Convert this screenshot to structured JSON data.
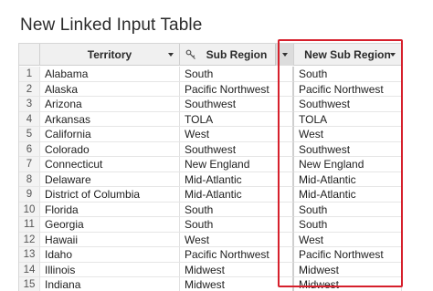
{
  "title": "New Linked Input Table",
  "columns": {
    "territory": "Territory",
    "sub_region": "Sub Region",
    "new_sub_region": "New Sub Region"
  },
  "icons": {
    "key": "key-icon",
    "dropdown": "chevron-down-icon"
  },
  "colors": {
    "highlight": "#d6202c",
    "header_bg": "#f0f0f0"
  },
  "rows": [
    {
      "n": "1",
      "territory": "Alabama",
      "sub_region": "South",
      "new_sub_region": "South"
    },
    {
      "n": "2",
      "territory": "Alaska",
      "sub_region": "Pacific Northwest",
      "new_sub_region": "Pacific Northwest"
    },
    {
      "n": "3",
      "territory": "Arizona",
      "sub_region": "Southwest",
      "new_sub_region": "Southwest"
    },
    {
      "n": "4",
      "territory": "Arkansas",
      "sub_region": "TOLA",
      "new_sub_region": "TOLA"
    },
    {
      "n": "5",
      "territory": "California",
      "sub_region": "West",
      "new_sub_region": "West"
    },
    {
      "n": "6",
      "territory": "Colorado",
      "sub_region": "Southwest",
      "new_sub_region": "Southwest"
    },
    {
      "n": "7",
      "territory": "Connecticut",
      "sub_region": "New England",
      "new_sub_region": "New England"
    },
    {
      "n": "8",
      "territory": "Delaware",
      "sub_region": "Mid-Atlantic",
      "new_sub_region": "Mid-Atlantic"
    },
    {
      "n": "9",
      "territory": "District of Columbia",
      "sub_region": "Mid-Atlantic",
      "new_sub_region": "Mid-Atlantic"
    },
    {
      "n": "10",
      "territory": "Florida",
      "sub_region": "South",
      "new_sub_region": "South"
    },
    {
      "n": "11",
      "territory": "Georgia",
      "sub_region": "South",
      "new_sub_region": "South"
    },
    {
      "n": "12",
      "territory": "Hawaii",
      "sub_region": "West",
      "new_sub_region": "West"
    },
    {
      "n": "13",
      "territory": "Idaho",
      "sub_region": "Pacific Northwest",
      "new_sub_region": "Pacific Northwest"
    },
    {
      "n": "14",
      "territory": "Illinois",
      "sub_region": "Midwest",
      "new_sub_region": "Midwest"
    },
    {
      "n": "15",
      "territory": "Indiana",
      "sub_region": "Midwest",
      "new_sub_region": "Midwest"
    }
  ]
}
